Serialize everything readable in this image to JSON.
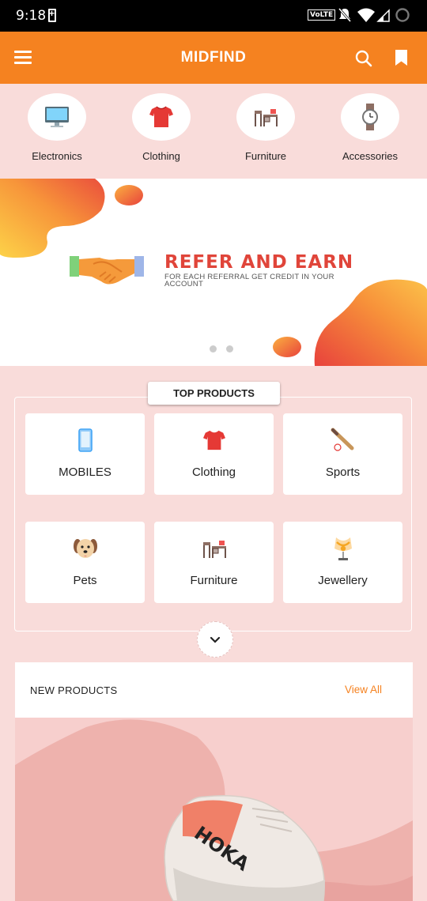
{
  "status_bar": {
    "time": "9:18",
    "network_badge": "VoLTE"
  },
  "app_bar": {
    "title": "MIDFIND",
    "icons": [
      "menu-icon",
      "search-icon",
      "bookmark-icon"
    ]
  },
  "categories": [
    {
      "label": "Electronics",
      "icon": "monitor-icon"
    },
    {
      "label": "Clothing",
      "icon": "tshirt-icon"
    },
    {
      "label": "Furniture",
      "icon": "desk-icon"
    },
    {
      "label": "Accessories",
      "icon": "watch-icon"
    }
  ],
  "banner": {
    "title": "REFER AND EARN",
    "subtitle": "FOR EACH REFERRAL GET CREDIT IN YOUR ACCOUNT",
    "slides": 2,
    "active_slide": 1
  },
  "top_products": {
    "title": "TOP PRODUCTS",
    "items": [
      {
        "label": "MOBILES",
        "icon": "mobile-icon"
      },
      {
        "label": "Clothing",
        "icon": "tshirt-icon"
      },
      {
        "label": "Sports",
        "icon": "baseball-bat-icon"
      },
      {
        "label": "Pets",
        "icon": "dog-icon"
      },
      {
        "label": "Furniture",
        "icon": "desk-icon"
      },
      {
        "label": "Jewellery",
        "icon": "necklace-icon"
      }
    ]
  },
  "new_products": {
    "title": "NEW PRODUCTS",
    "view_all": "View All",
    "shoe_brand": "HOKA"
  },
  "colors": {
    "primary": "#f58220",
    "background": "#f9dcda",
    "banner_accent": "#e0453a"
  }
}
